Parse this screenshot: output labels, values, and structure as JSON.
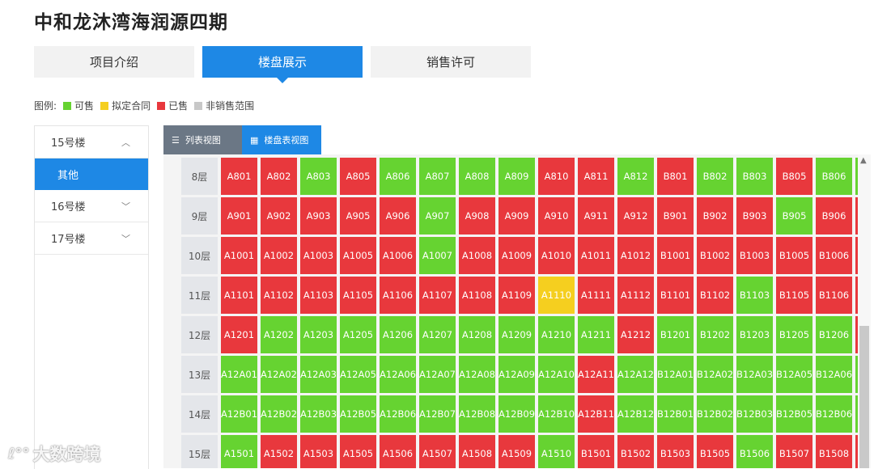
{
  "page": {
    "title": "中和龙沐湾海润源四期"
  },
  "tabs": [
    {
      "label": "项目介绍",
      "active": false
    },
    {
      "label": "楼盘展示",
      "active": true
    },
    {
      "label": "销售许可",
      "active": false
    }
  ],
  "legend": {
    "prefix": "图例:",
    "items": [
      {
        "label": "可售",
        "color": "#66d331"
      },
      {
        "label": "拟定合同",
        "color": "#f5cf1f"
      },
      {
        "label": "已售",
        "color": "#e8383d"
      },
      {
        "label": "非销售范围",
        "color": "#c8c8c8"
      }
    ]
  },
  "sidebar": {
    "buildings": [
      {
        "label": "15号楼",
        "icon": "chevron-up-icon",
        "glyph": "︿"
      },
      {
        "label": "16号楼",
        "icon": "chevron-down-icon",
        "glyph": "﹀"
      },
      {
        "label": "17号楼",
        "icon": "chevron-down-icon",
        "glyph": "﹀"
      }
    ],
    "subitem": {
      "label": "其他",
      "selected": true
    }
  },
  "view_tabs": [
    {
      "label": "列表视图",
      "icon": "list-icon",
      "glyph": "☰"
    },
    {
      "label": "楼盘表视图",
      "icon": "grid-icon",
      "glyph": "▦"
    }
  ],
  "status_colors": {
    "available": "#66d331",
    "sold": "#e8383d",
    "pending": "#f5cf1f",
    "excluded": "#c8c8c8"
  },
  "board": {
    "floors": [
      {
        "label": "8层",
        "units": [
          [
            "A801",
            "sold"
          ],
          [
            "A802",
            "sold"
          ],
          [
            "A803",
            "available"
          ],
          [
            "A805",
            "sold"
          ],
          [
            "A806",
            "available"
          ],
          [
            "A807",
            "available"
          ],
          [
            "A808",
            "available"
          ],
          [
            "A809",
            "available"
          ],
          [
            "A810",
            "sold"
          ],
          [
            "A811",
            "sold"
          ],
          [
            "A812",
            "available"
          ],
          [
            "B801",
            "sold"
          ],
          [
            "B802",
            "available"
          ],
          [
            "B803",
            "available"
          ],
          [
            "B805",
            "sold"
          ],
          [
            "B806",
            "available"
          ],
          [
            "",
            "available"
          ]
        ]
      },
      {
        "label": "9层",
        "units": [
          [
            "A901",
            "sold"
          ],
          [
            "A902",
            "sold"
          ],
          [
            "A903",
            "sold"
          ],
          [
            "A905",
            "sold"
          ],
          [
            "A906",
            "sold"
          ],
          [
            "A907",
            "available"
          ],
          [
            "A908",
            "sold"
          ],
          [
            "A909",
            "sold"
          ],
          [
            "A910",
            "sold"
          ],
          [
            "A911",
            "sold"
          ],
          [
            "A912",
            "sold"
          ],
          [
            "B901",
            "sold"
          ],
          [
            "B902",
            "sold"
          ],
          [
            "B903",
            "sold"
          ],
          [
            "B905",
            "available"
          ],
          [
            "B906",
            "sold"
          ],
          [
            "",
            "sold"
          ]
        ]
      },
      {
        "label": "10层",
        "units": [
          [
            "A1001",
            "sold"
          ],
          [
            "A1002",
            "sold"
          ],
          [
            "A1003",
            "sold"
          ],
          [
            "A1005",
            "sold"
          ],
          [
            "A1006",
            "sold"
          ],
          [
            "A1007",
            "available"
          ],
          [
            "A1008",
            "sold"
          ],
          [
            "A1009",
            "sold"
          ],
          [
            "A1010",
            "sold"
          ],
          [
            "A1011",
            "sold"
          ],
          [
            "A1012",
            "sold"
          ],
          [
            "B1001",
            "sold"
          ],
          [
            "B1002",
            "sold"
          ],
          [
            "B1003",
            "sold"
          ],
          [
            "B1005",
            "sold"
          ],
          [
            "B1006",
            "sold"
          ],
          [
            "",
            "sold"
          ]
        ]
      },
      {
        "label": "11层",
        "units": [
          [
            "A1101",
            "sold"
          ],
          [
            "A1102",
            "sold"
          ],
          [
            "A1103",
            "sold"
          ],
          [
            "A1105",
            "sold"
          ],
          [
            "A1106",
            "sold"
          ],
          [
            "A1107",
            "sold"
          ],
          [
            "A1108",
            "sold"
          ],
          [
            "A1109",
            "sold"
          ],
          [
            "A1110",
            "pending"
          ],
          [
            "A1111",
            "sold"
          ],
          [
            "A1112",
            "sold"
          ],
          [
            "B1101",
            "sold"
          ],
          [
            "B1102",
            "sold"
          ],
          [
            "B1103",
            "available"
          ],
          [
            "B1105",
            "sold"
          ],
          [
            "B1106",
            "sold"
          ],
          [
            "",
            "sold"
          ]
        ]
      },
      {
        "label": "12层",
        "units": [
          [
            "A1201",
            "sold"
          ],
          [
            "A1202",
            "available"
          ],
          [
            "A1203",
            "available"
          ],
          [
            "A1205",
            "available"
          ],
          [
            "A1206",
            "available"
          ],
          [
            "A1207",
            "available"
          ],
          [
            "A1208",
            "available"
          ],
          [
            "A1209",
            "available"
          ],
          [
            "A1210",
            "available"
          ],
          [
            "A1211",
            "available"
          ],
          [
            "A1212",
            "sold"
          ],
          [
            "B1201",
            "available"
          ],
          [
            "B1202",
            "available"
          ],
          [
            "B1203",
            "available"
          ],
          [
            "B1205",
            "available"
          ],
          [
            "B1206",
            "available"
          ],
          [
            "",
            "sold"
          ]
        ]
      },
      {
        "label": "13层",
        "units": [
          [
            "A12A01",
            "available"
          ],
          [
            "A12A02",
            "available"
          ],
          [
            "A12A03",
            "available"
          ],
          [
            "A12A05",
            "available"
          ],
          [
            "A12A06",
            "available"
          ],
          [
            "A12A07",
            "available"
          ],
          [
            "A12A08",
            "available"
          ],
          [
            "A12A09",
            "available"
          ],
          [
            "A12A10",
            "available"
          ],
          [
            "A12A11",
            "sold"
          ],
          [
            "A12A12",
            "available"
          ],
          [
            "B12A01",
            "available"
          ],
          [
            "B12A02",
            "available"
          ],
          [
            "B12A03",
            "available"
          ],
          [
            "B12A05",
            "available"
          ],
          [
            "B12A06",
            "available"
          ],
          [
            "B",
            "available"
          ]
        ]
      },
      {
        "label": "14层",
        "units": [
          [
            "A12B01",
            "available"
          ],
          [
            "A12B02",
            "available"
          ],
          [
            "A12B03",
            "available"
          ],
          [
            "A12B05",
            "available"
          ],
          [
            "A12B06",
            "available"
          ],
          [
            "A12B07",
            "available"
          ],
          [
            "A12B08",
            "available"
          ],
          [
            "A12B09",
            "available"
          ],
          [
            "A12B10",
            "available"
          ],
          [
            "A12B11",
            "sold"
          ],
          [
            "A12B12",
            "available"
          ],
          [
            "B12B01",
            "available"
          ],
          [
            "B12B02",
            "available"
          ],
          [
            "B12B03",
            "available"
          ],
          [
            "B12B05",
            "available"
          ],
          [
            "B12B06",
            "available"
          ],
          [
            "B",
            "available"
          ]
        ]
      },
      {
        "label": "15层",
        "units": [
          [
            "A1501",
            "available"
          ],
          [
            "A1502",
            "sold"
          ],
          [
            "A1503",
            "sold"
          ],
          [
            "A1505",
            "sold"
          ],
          [
            "A1506",
            "sold"
          ],
          [
            "A1507",
            "sold"
          ],
          [
            "A1508",
            "sold"
          ],
          [
            "A1509",
            "sold"
          ],
          [
            "A1510",
            "available"
          ],
          [
            "B1501",
            "sold"
          ],
          [
            "B1502",
            "sold"
          ],
          [
            "B1503",
            "sold"
          ],
          [
            "B1505",
            "sold"
          ],
          [
            "B1506",
            "available"
          ],
          [
            "B1507",
            "sold"
          ],
          [
            "B1508",
            "sold"
          ],
          [
            "",
            "sold"
          ]
        ]
      }
    ]
  },
  "watermark": {
    "text": "大数跨境",
    "icon": "logo-icon",
    "glyph": "ℓ°°"
  }
}
